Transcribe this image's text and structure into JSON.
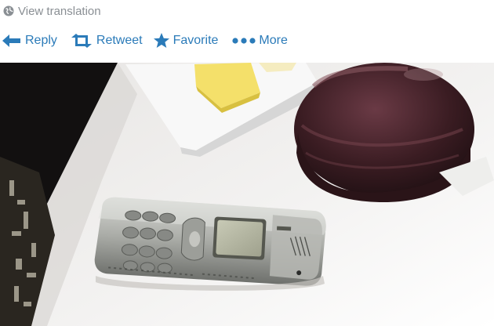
{
  "tweet": {
    "view_translation": "View translation",
    "actions": {
      "reply": "Reply",
      "retweet": "Retweet",
      "favorite": "Favorite",
      "more": "More"
    }
  },
  "photo": {
    "subject": "phone-on-table"
  },
  "colors": {
    "link": "#2b7bb9",
    "muted": "#8a8f94"
  }
}
